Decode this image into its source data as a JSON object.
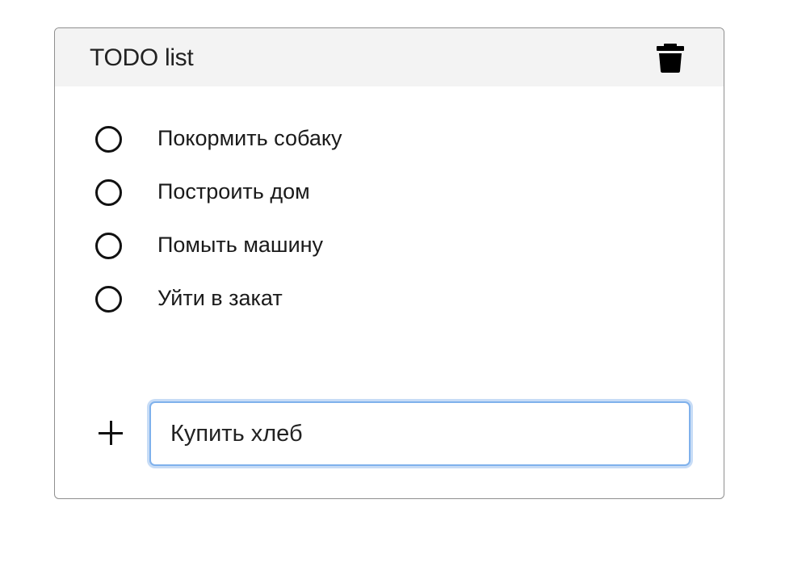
{
  "header": {
    "title": "TODO list",
    "clear_icon": "trash-icon"
  },
  "todos": [
    {
      "label": "Покормить собаку",
      "done": false
    },
    {
      "label": "Построить дом",
      "done": false
    },
    {
      "label": "Помыть машину",
      "done": false
    },
    {
      "label": "Уйти в закат",
      "done": false
    }
  ],
  "new_todo": {
    "add_icon": "plus-icon",
    "value": "Купить хлеб",
    "placeholder": ""
  },
  "colors": {
    "header_background": "#f3f3f3",
    "card_border": "#8f8f8f",
    "input_focus_border": "#7fb1ec",
    "input_focus_glow": "#c7dcf6",
    "text": "#111111"
  }
}
